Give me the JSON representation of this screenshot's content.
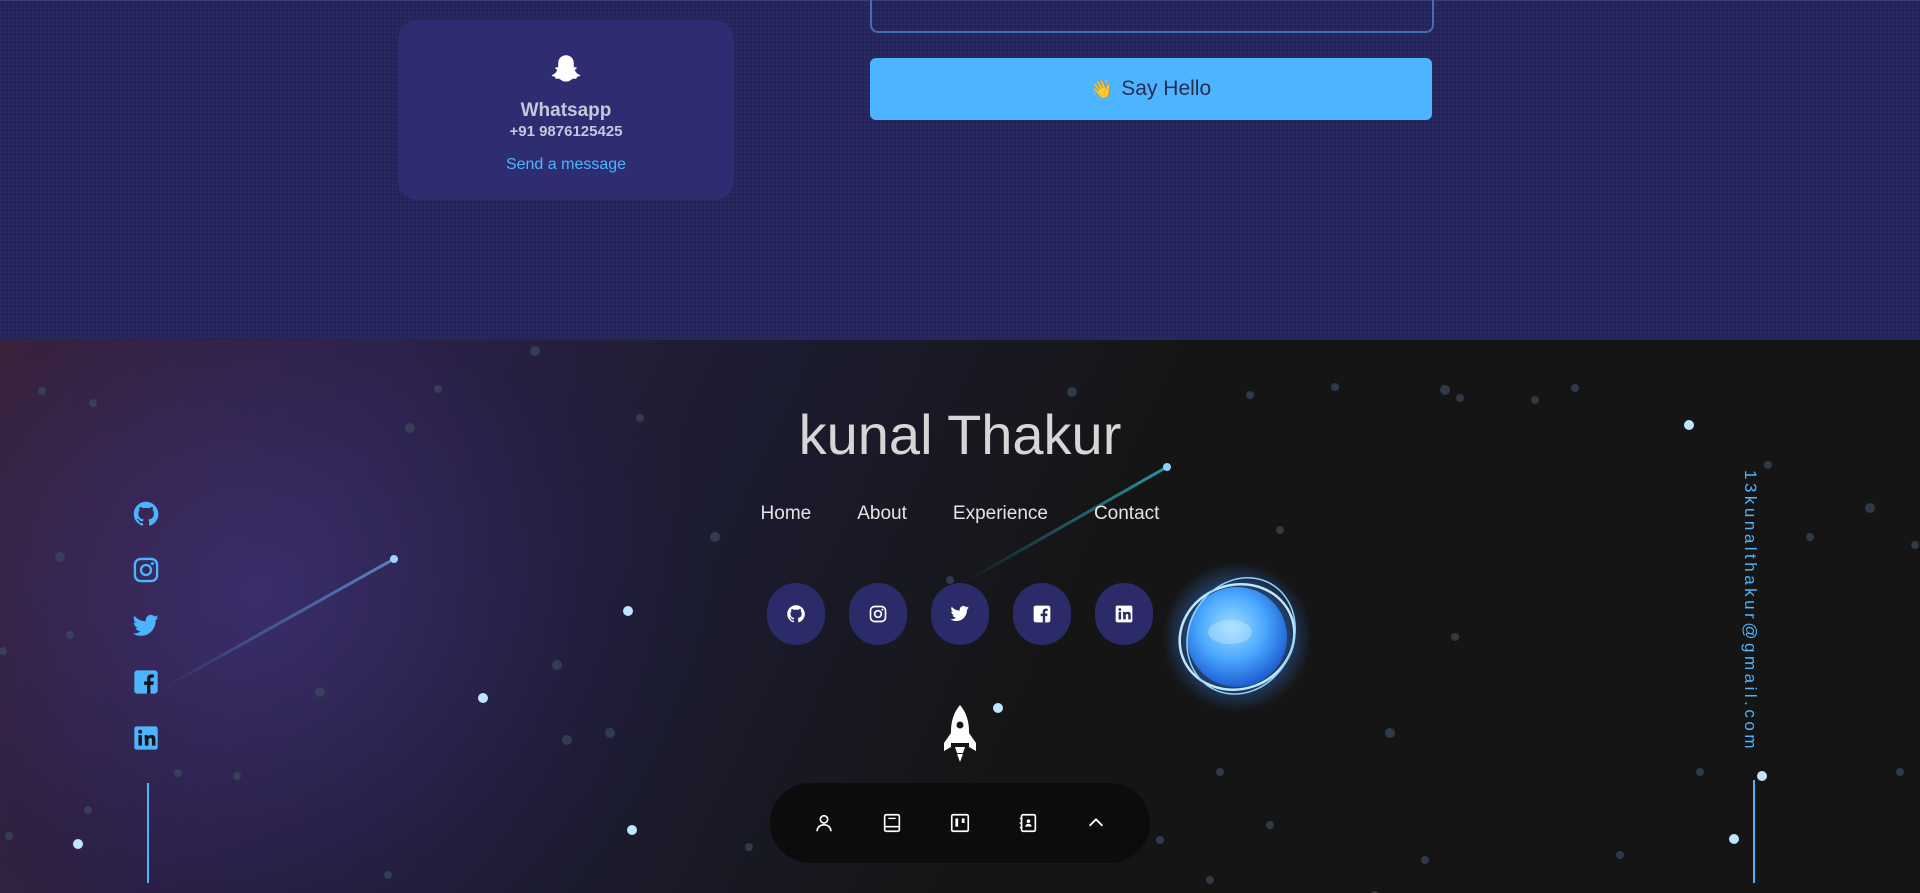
{
  "contact": {
    "card": {
      "icon": "snapchat-ghost-icon",
      "title": "Whatsapp",
      "value": "+91 9876125425",
      "link_label": "Send a message"
    },
    "submit_label": "Say Hello",
    "submit_icon": "👋"
  },
  "footer": {
    "name": "kunal Thakur",
    "nav": [
      "Home",
      "About",
      "Experience",
      "Contact"
    ],
    "socials": [
      "github-icon",
      "instagram-icon",
      "twitter-icon",
      "facebook-icon",
      "linkedin-icon"
    ],
    "email": "13kunalthakur@gmail.com",
    "dock": [
      "user-icon",
      "book-icon",
      "board-icon",
      "contact-book-icon",
      "chevron-up-icon"
    ]
  },
  "colors": {
    "accent": "#4db5ff",
    "contact_bg": "#24245c",
    "card_bg": "#2e2d72",
    "footer_bg": "#151515",
    "social_btn_bg": "#2b2b6a"
  }
}
